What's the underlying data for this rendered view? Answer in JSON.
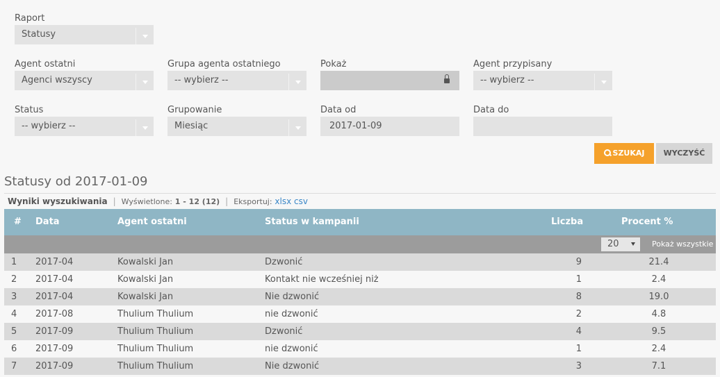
{
  "filters": {
    "raport": {
      "label": "Raport",
      "value": "Statusy"
    },
    "agent_ostatni": {
      "label": "Agent ostatni",
      "value": "Agenci wszyscy"
    },
    "grupa_agenta": {
      "label": "Grupa agenta ostatniego",
      "value": "-- wybierz --"
    },
    "pokaz": {
      "label": "Pokaż",
      "value": ""
    },
    "agent_przypisany": {
      "label": "Agent przypisany",
      "value": "-- wybierz --"
    },
    "status": {
      "label": "Status",
      "value": "-- wybierz --"
    },
    "grupowanie": {
      "label": "Grupowanie",
      "value": "Miesiąc"
    },
    "data_od": {
      "label": "Data od",
      "value": "2017-01-09"
    },
    "data_do": {
      "label": "Data do",
      "value": ""
    }
  },
  "buttons": {
    "search": "SZUKAJ",
    "clear": "WYCZYŚĆ"
  },
  "section_title": "Statusy od 2017-01-09",
  "results_bar": {
    "title": "Wyniki wyszukiwania",
    "displayed_label": "Wyświetlone:",
    "displayed_value": "1 - 12 (12)",
    "export_label": "Eksportuj:",
    "export_xlsx": "xlsx",
    "export_csv": "csv"
  },
  "table": {
    "headers": {
      "num": "#",
      "date": "Data",
      "agent": "Agent ostatni",
      "status": "Status w kampanii",
      "count": "Liczba",
      "pct": "Procent %"
    },
    "page_size": "20",
    "show_all": "Pokaż wszystkie",
    "rows": [
      {
        "num": "1",
        "date": "2017-04",
        "agent": "Kowalski Jan",
        "status": "Dzwonić",
        "count": "9",
        "pct": "21.4"
      },
      {
        "num": "2",
        "date": "2017-04",
        "agent": "Kowalski Jan",
        "status": "Kontakt nie wcześniej niż",
        "count": "1",
        "pct": "2.4"
      },
      {
        "num": "3",
        "date": "2017-04",
        "agent": "Kowalski Jan",
        "status": "Nie dzwonić",
        "count": "8",
        "pct": "19.0"
      },
      {
        "num": "4",
        "date": "2017-08",
        "agent": "Thulium Thulium",
        "status": "nie dzwonić",
        "count": "2",
        "pct": "4.8"
      },
      {
        "num": "5",
        "date": "2017-09",
        "agent": "Thulium Thulium",
        "status": "Dzwonić",
        "count": "4",
        "pct": "9.5"
      },
      {
        "num": "6",
        "date": "2017-09",
        "agent": "Thulium Thulium",
        "status": "nie dzwonić",
        "count": "1",
        "pct": "2.4"
      },
      {
        "num": "7",
        "date": "2017-09",
        "agent": "Thulium Thulium",
        "status": "Nie dzwonić",
        "count": "3",
        "pct": "7.1"
      }
    ]
  }
}
